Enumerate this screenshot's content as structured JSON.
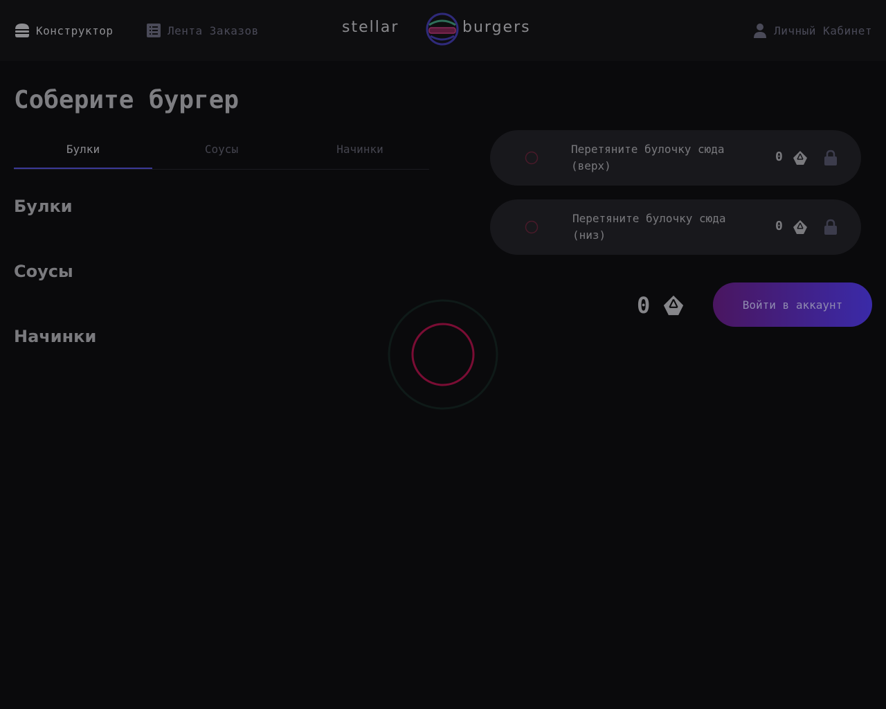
{
  "header": {
    "constructor_label": "Конструктор",
    "feed_label": "Лента Заказов",
    "profile_label": "Личный Кабинет",
    "logo_text_left": "stellar",
    "logo_text_right": "burgers"
  },
  "main": {
    "title": "Соберите бургер",
    "tabs": [
      {
        "label": "Булки",
        "active": true
      },
      {
        "label": "Соусы",
        "active": false
      },
      {
        "label": "Начинки",
        "active": false
      }
    ],
    "sections": [
      "Булки",
      "Соусы",
      "Начинки"
    ]
  },
  "constructor": {
    "top_slot": {
      "text": "Перетяните булочку сюда (верх)",
      "price": "0"
    },
    "bottom_slot": {
      "text": "Перетяните булочку сюда (низ)",
      "price": "0"
    },
    "total": "0",
    "order_button": "Войти в аккаунт"
  },
  "colors": {
    "background": "#0a0a0c",
    "header": "#0e0e10",
    "accent": "#3b3998",
    "button_gradient_start": "#4a1660",
    "button_gradient_end": "#3a2aa8",
    "loader": "#7a0d34"
  },
  "icons": [
    "burger-icon",
    "list-icon",
    "user-icon",
    "currency-icon",
    "lock-icon",
    "loader-spinner"
  ]
}
